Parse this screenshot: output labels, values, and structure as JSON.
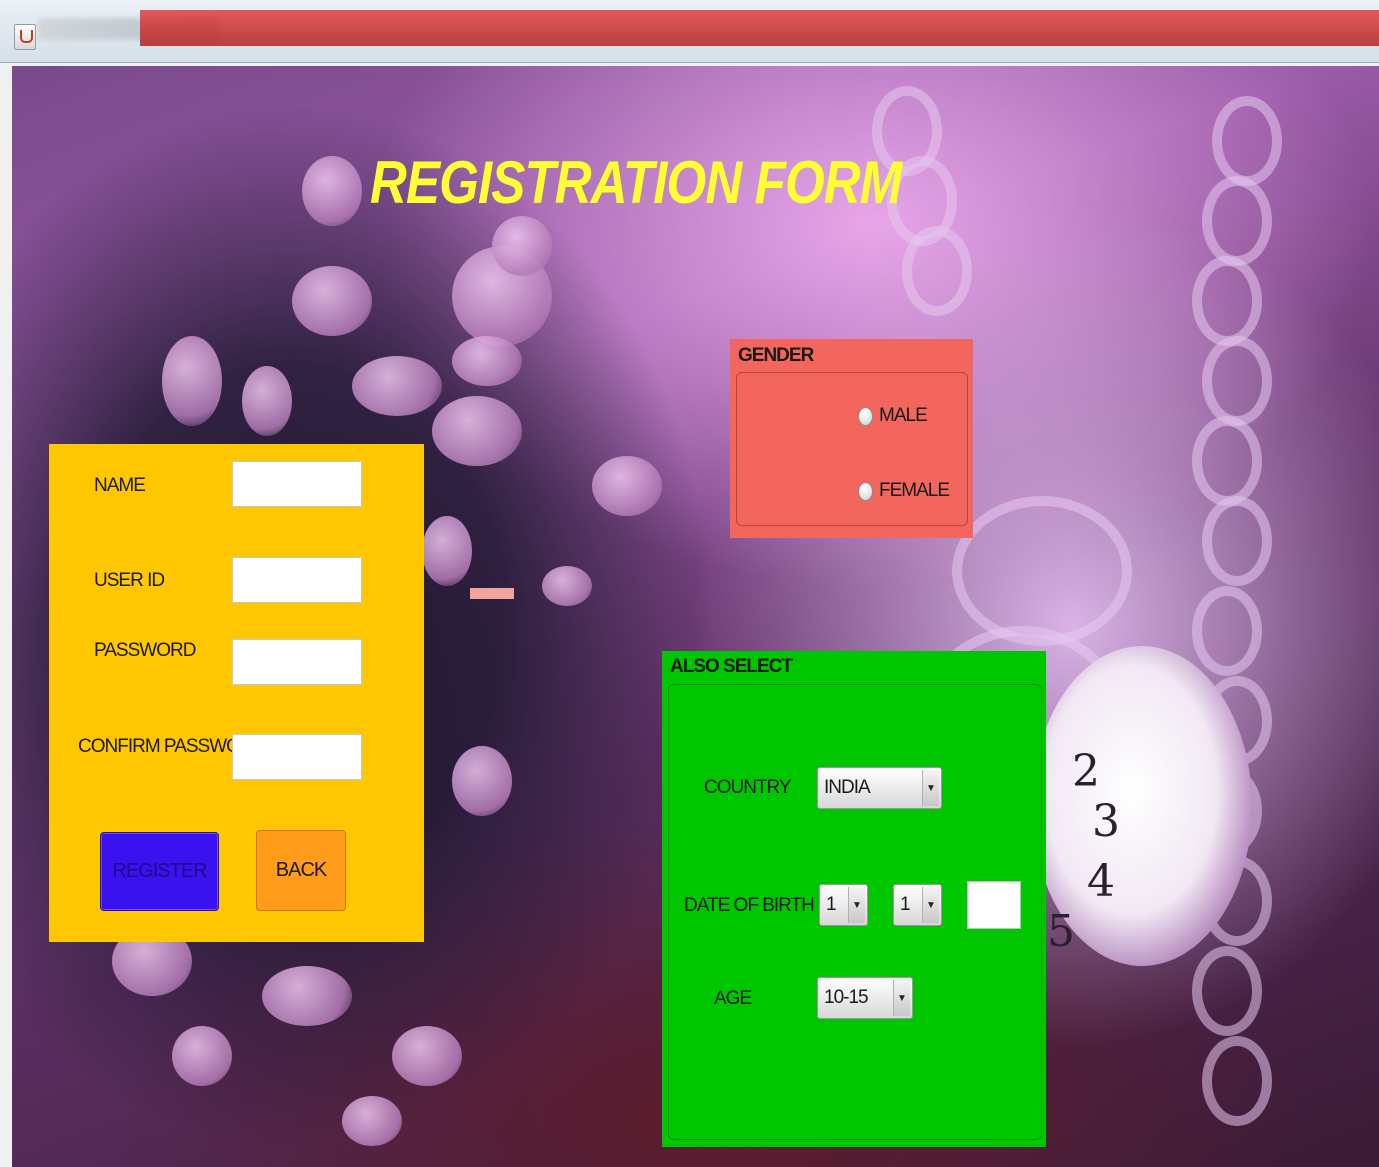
{
  "window": {
    "title": ""
  },
  "title": "REGISTRATION FORM",
  "form": {
    "name_label": "NAME",
    "userid_label": "USER ID",
    "password_label": "PASSWORD",
    "confirm_label": "CONFIRM PASSWORD",
    "name_value": "",
    "userid_value": "",
    "password_value": "",
    "confirm_value": "",
    "register_label": "REGISTER",
    "back_label": "BACK"
  },
  "gender": {
    "title": "GENDER",
    "options": [
      "MALE",
      "FEMALE"
    ]
  },
  "also_select": {
    "title": "ALSO SELECT",
    "country_label": "COUNTRY",
    "country_value": "INDIA",
    "dob_label": "DATE OF BIRTH",
    "day_value": "1",
    "month_value": "1",
    "year_value": "",
    "age_label": "AGE",
    "age_value": "10-15"
  },
  "colors": {
    "title": "#ffff33",
    "form_panel": "#ffc702",
    "gender_panel": "#f2665e",
    "select_panel": "#00c600",
    "register_button": "#3a12f0",
    "back_button": "#ff9c1a"
  },
  "icons": [
    "java-icon",
    "radio-icon",
    "dropdown-arrow-icon"
  ]
}
